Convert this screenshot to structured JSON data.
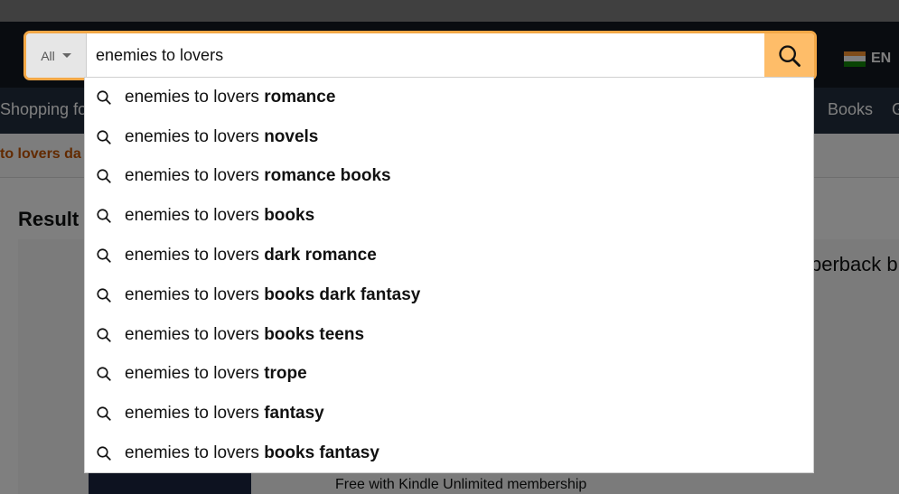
{
  "search": {
    "scope_label": "All",
    "query": "enemies to lovers"
  },
  "header": {
    "locale": "EN",
    "shopping_for": "Shopping fo",
    "books": "Books",
    "g": "G"
  },
  "breadcrumb": {
    "text": "to lovers da"
  },
  "results": {
    "heading": "Result",
    "paperback": "perback b",
    "kindle": "Free with Kindle Unlimited membership"
  },
  "suggestions": [
    {
      "prefix": "enemies to lovers ",
      "suffix": "romance"
    },
    {
      "prefix": "enemies to lovers ",
      "suffix": "novels"
    },
    {
      "prefix": "enemies to lovers ",
      "suffix": "romance books"
    },
    {
      "prefix": "enemies to lovers ",
      "suffix": "books"
    },
    {
      "prefix": "enemies to lovers ",
      "suffix": "dark romance"
    },
    {
      "prefix": "enemies to lovers ",
      "suffix": "books dark fantasy"
    },
    {
      "prefix": "enemies to lovers ",
      "suffix": "books teens"
    },
    {
      "prefix": "enemies to lovers ",
      "suffix": "trope"
    },
    {
      "prefix": "enemies to lovers ",
      "suffix": "fantasy"
    },
    {
      "prefix": "enemies to lovers ",
      "suffix": "books fantasy"
    }
  ],
  "colors": {
    "accent": "#febd69",
    "focus_border": "#f3a847",
    "nav_bg": "#131921",
    "subnav_bg": "#232f3e"
  }
}
